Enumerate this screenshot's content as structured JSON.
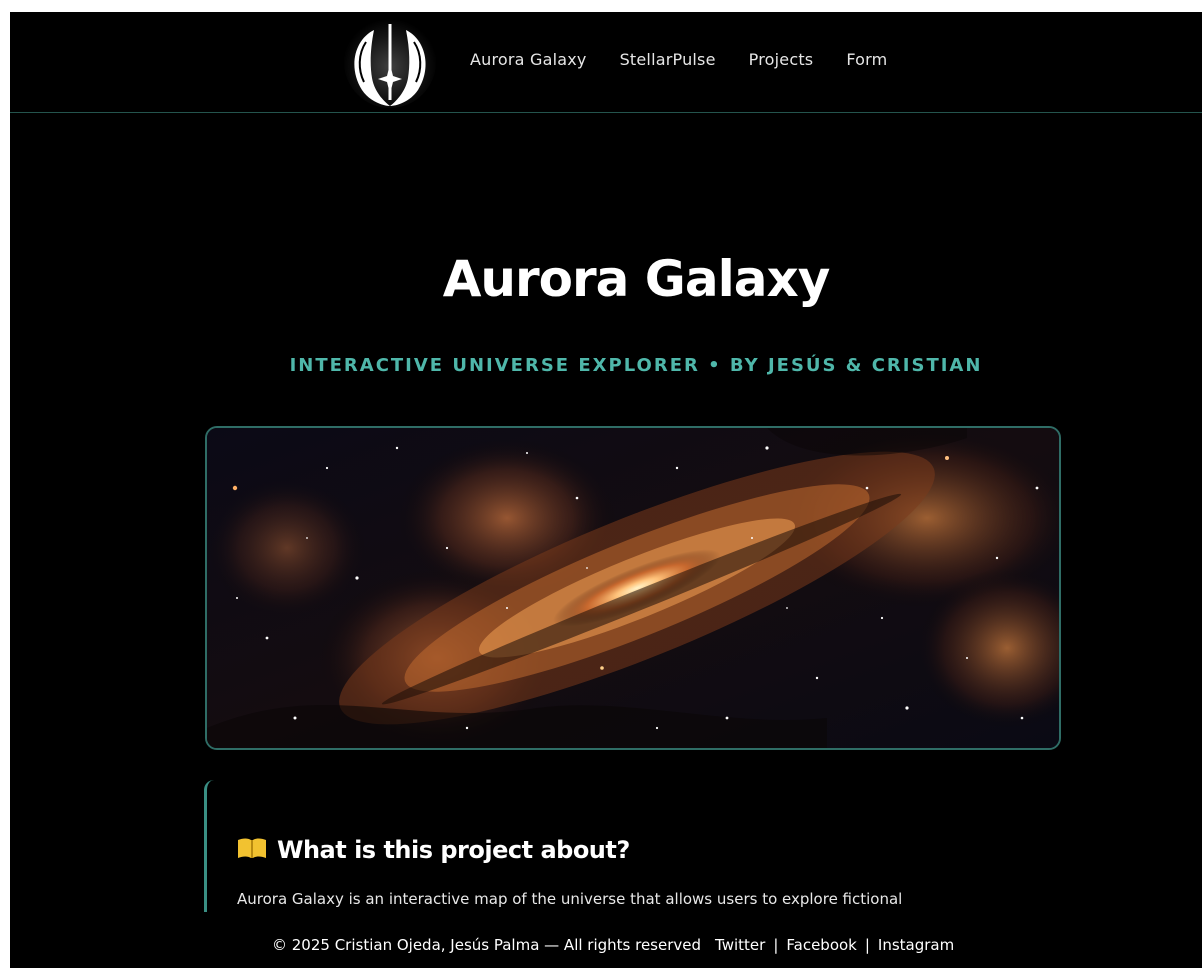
{
  "header": {
    "nav": [
      {
        "label": "Aurora Galaxy"
      },
      {
        "label": "StellarPulse"
      },
      {
        "label": "Projects"
      },
      {
        "label": "Form"
      }
    ],
    "logo_icon": "jedi-order-emblem-icon"
  },
  "hero": {
    "title": "Aurora Galaxy",
    "subtitle": "INTERACTIVE UNIVERSE EXPLORER • BY JESÚS & CRISTIAN"
  },
  "about": {
    "icon": "open-book-icon",
    "heading": "What is this project about?",
    "text": "Aurora Galaxy is an interactive map of the universe that allows users to explore fictional"
  },
  "footer": {
    "copyright": "© 2025 Cristian Ojeda, Jesús Palma — All rights reserved",
    "links": [
      {
        "label": "Twitter"
      },
      {
        "label": "Facebook"
      },
      {
        "label": "Instagram"
      }
    ],
    "separator": "|"
  },
  "colors": {
    "background": "#000000",
    "accent": "#4fb7aa",
    "border": "#2f6d66",
    "book_icon": "#f2c230"
  }
}
